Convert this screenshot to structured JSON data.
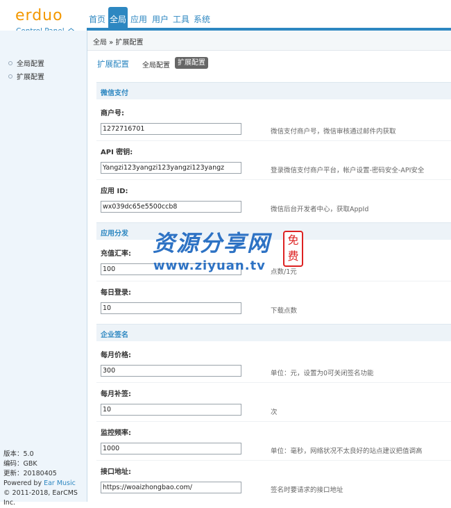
{
  "brand": {
    "name": "erduo",
    "subtitle": "Control Panel"
  },
  "nav": {
    "tabs": [
      "首页",
      "全局",
      "应用",
      "用户",
      "工具",
      "系统"
    ],
    "active": "全局"
  },
  "breadcrumb": "全局 » 扩展配置",
  "sidebar": {
    "items": [
      "全局配置",
      "扩展配置"
    ],
    "info": {
      "version": "版本：5.0",
      "encoding": "编码：GBK",
      "updated": "更新：20180405",
      "powered_prefix": "Powered by ",
      "powered_link": "Ear Music",
      "copyright": "© 2011-2018, EarCMS Inc."
    }
  },
  "page": {
    "title": "扩展配置",
    "tabs": [
      "全局配置",
      "扩展配置"
    ],
    "active_tab": "扩展配置"
  },
  "sections": [
    {
      "title": "微信支付",
      "fields": [
        {
          "label": "商户号:",
          "value": "1272716701",
          "hint": "微信支付商户号，微信审核通过邮件内获取"
        },
        {
          "label": "API 密钥:",
          "value": "Yangzi123yangzi123yangzi123yangz",
          "hint": "登录微信支付商户平台，帐户设置-密码安全-API安全"
        },
        {
          "label": "应用 ID:",
          "value": "wx039dc65e5500ccb8",
          "hint": "微信后台开发者中心，获取AppId"
        }
      ]
    },
    {
      "title": "应用分发",
      "fields": [
        {
          "label": "充值汇率:",
          "value": "100",
          "hint": "点数/1元"
        },
        {
          "label": "每日登录:",
          "value": "10",
          "hint": "下载点数"
        }
      ]
    },
    {
      "title": "企业签名",
      "fields": [
        {
          "label": "每月价格:",
          "value": "300",
          "hint": "单位：元，设置为0可关闭签名功能"
        },
        {
          "label": "每月补签:",
          "value": "10",
          "hint": "次"
        },
        {
          "label": "监控频率:",
          "value": "1000",
          "hint": "单位：毫秒，网络状况不太良好的站点建议把值调高"
        },
        {
          "label": "接口地址:",
          "value": "https://woaizhongbao.com/",
          "hint": "签名时要请求的接口地址"
        }
      ]
    }
  ],
  "watermark": {
    "text": "资源分享网",
    "url": "www.ziyuan.tv",
    "seal": "免费"
  },
  "colors": {
    "accent": "#2d87c1",
    "brand": "#f39800"
  }
}
